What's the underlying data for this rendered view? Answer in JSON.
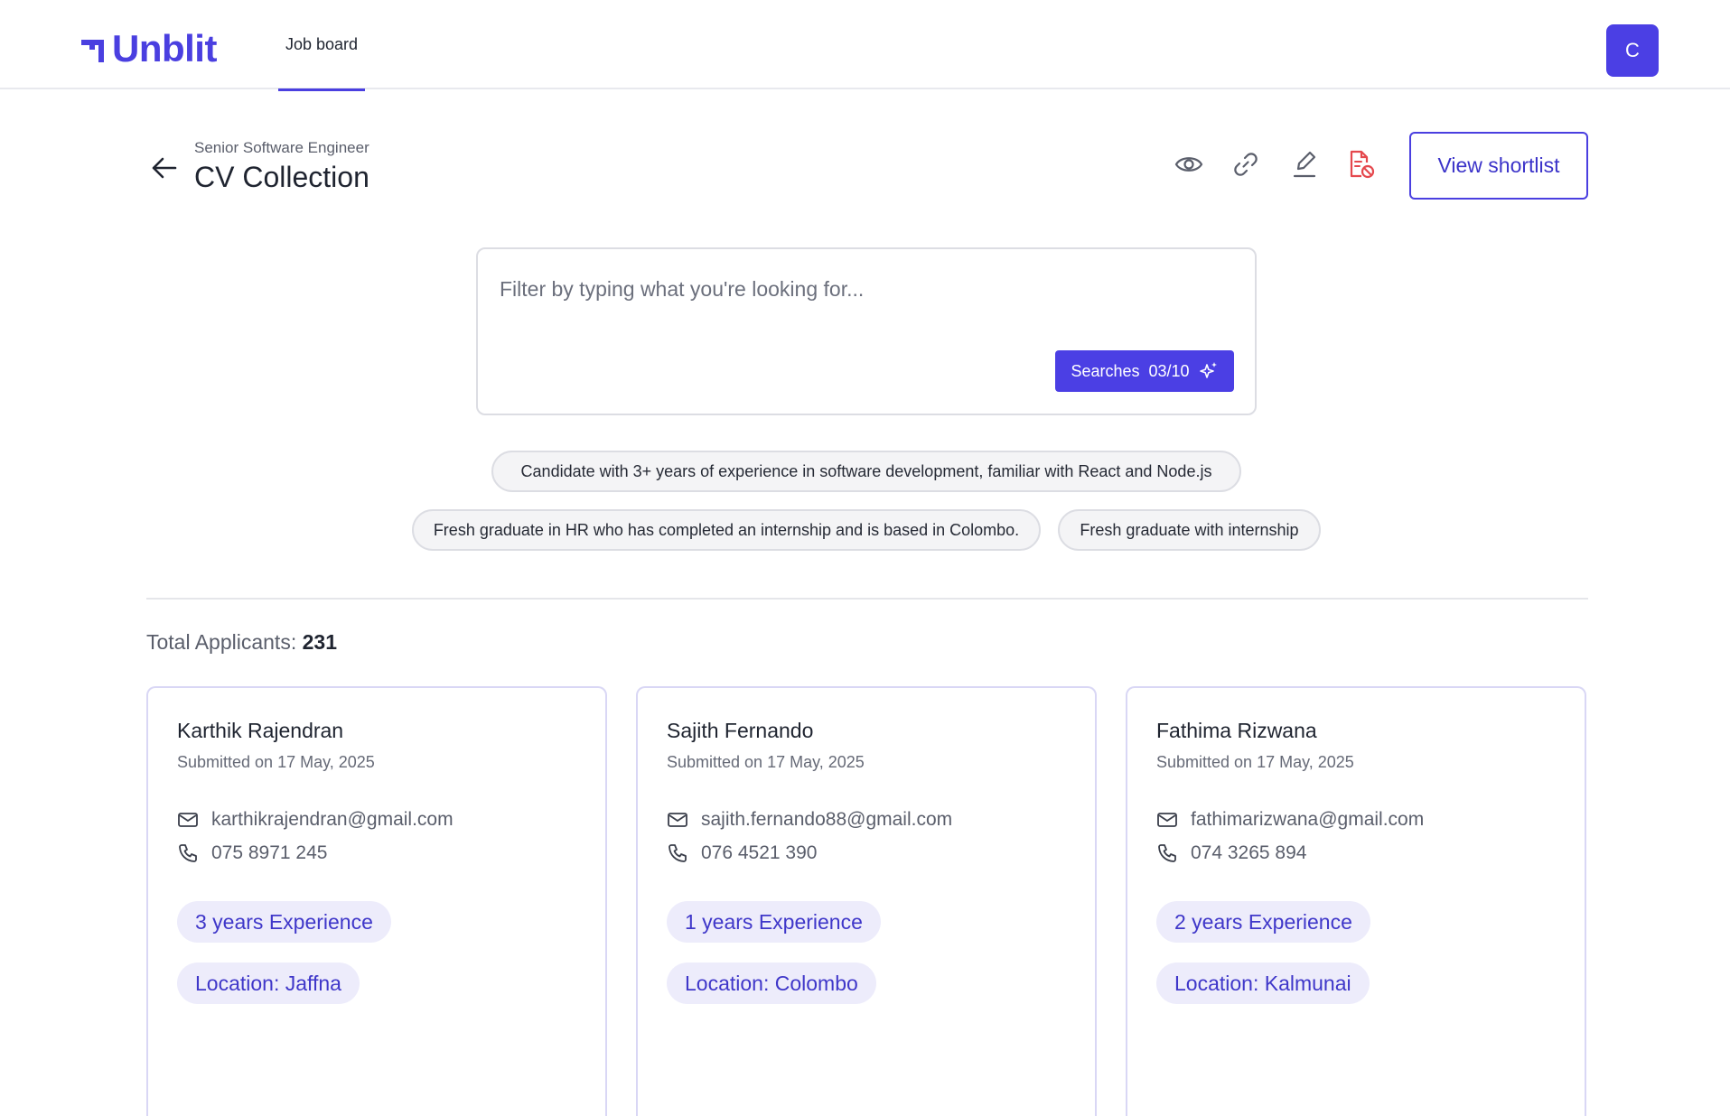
{
  "header": {
    "logo_text": "Unblit",
    "nav_tab": "Job board",
    "avatar_initial": "C"
  },
  "page": {
    "subtitle": "Senior Software Engineer",
    "title": "CV Collection",
    "view_shortlist_label": "View shortlist",
    "icons": [
      "eye-icon",
      "link-icon",
      "edit-icon",
      "file-blocked-icon"
    ],
    "accent_color": "#4b3fe4",
    "danger_color": "#e5484d"
  },
  "filter": {
    "placeholder": "Filter by typing what you're looking for...",
    "searches_label": "Searches",
    "searches_count": "03/10"
  },
  "suggestions": [
    "Candidate with 3+ years of experience in software development, familiar with React and Node.js",
    "Fresh graduate in HR who has completed an internship and is based in Colombo.",
    "Fresh graduate with internship"
  ],
  "summary": {
    "total_label": "Total Applicants:",
    "total_value": "231"
  },
  "candidates": [
    {
      "name": "Karthik Rajendran",
      "submitted": "Submitted on 17 May, 2025",
      "email": "karthikrajendran@gmail.com",
      "phone": "075 8971 245",
      "experience": "3 years Experience",
      "location": "Location: Jaffna"
    },
    {
      "name": "Sajith Fernando",
      "submitted": "Submitted on 17 May, 2025",
      "email": "sajith.fernando88@gmail.com",
      "phone": "076 4521 390",
      "experience": "1 years Experience",
      "location": "Location: Colombo"
    },
    {
      "name": "Fathima Rizwana",
      "submitted": "Submitted on 17 May, 2025",
      "email": "fathimarizwana@gmail.com",
      "phone": "074 3265 894",
      "experience": "2 years Experience",
      "location": "Location: Kalmunai"
    }
  ]
}
